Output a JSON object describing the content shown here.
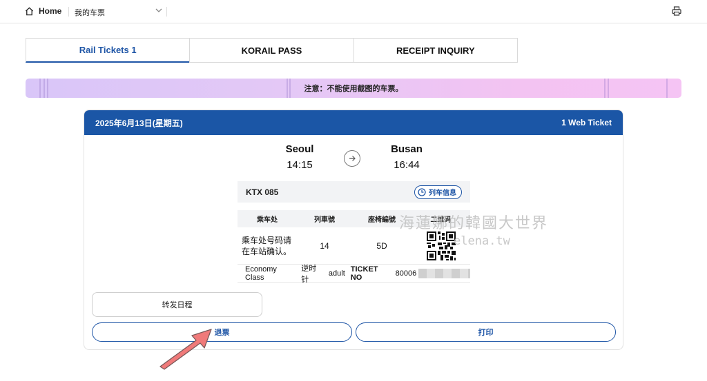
{
  "topbar": {
    "home_label": "Home",
    "breadcrumb": "我的车票"
  },
  "tabs": [
    {
      "label": "Rail Tickets 1",
      "active": true
    },
    {
      "label": "KORAIL PASS",
      "active": false
    },
    {
      "label": "RECEIPT INQUIRY",
      "active": false
    }
  ],
  "notice": "注意：不能使用截图的车票。",
  "ticket": {
    "date": "2025年6月13日(星期五)",
    "count": "1 Web Ticket",
    "departure": {
      "station": "Seoul",
      "time": "14:15"
    },
    "arrival": {
      "station": "Busan",
      "time": "16:44"
    },
    "train_no": "KTX 085",
    "train_info_label": "列车信息",
    "columns": [
      "乘车处",
      "列車號",
      "座椅編號",
      "二维码"
    ],
    "boarding_line1": "乘车处号码请",
    "boarding_line2": "在车站确认。",
    "car": "14",
    "seat": "5D",
    "class_text": "Economy Class",
    "direction": "逆时针",
    "passenger": "adult",
    "ticket_no_label": "TICKET NO",
    "ticket_no_prefix": "80006"
  },
  "buttons": {
    "share": "转发日程",
    "refund": "退票",
    "print": "打印"
  },
  "watermark": {
    "line1": "海蓮娜的韓國大世界",
    "line2": "elena.tw"
  },
  "colors": {
    "brand_blue": "#1b56a6",
    "pointer_red": "#f07a7a"
  }
}
